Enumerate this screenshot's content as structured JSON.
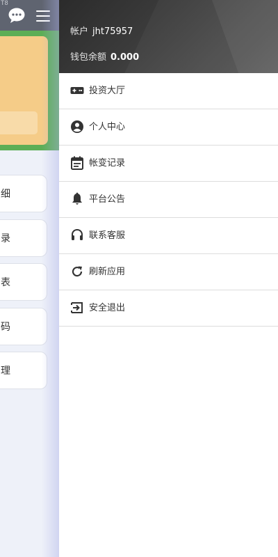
{
  "background_app": {
    "corner_text": "T8",
    "list_items": [
      {
        "label": "细"
      },
      {
        "label": "录"
      },
      {
        "label": "表"
      },
      {
        "label": "码"
      },
      {
        "label": "理"
      }
    ]
  },
  "drawer": {
    "account_label": "帐户",
    "account_value": "jht75957",
    "balance_label": "钱包余额",
    "balance_value": "0.000",
    "menu": [
      {
        "label": "投资大厅",
        "icon": "gamepad-icon"
      },
      {
        "label": "个人中心",
        "icon": "user-circle-icon"
      },
      {
        "label": "帐变记录",
        "icon": "calendar-icon"
      },
      {
        "label": "平台公告",
        "icon": "bell-icon"
      },
      {
        "label": "联系客服",
        "icon": "headset-icon"
      },
      {
        "label": "刷新应用",
        "icon": "refresh-icon"
      },
      {
        "label": "安全退出",
        "icon": "logout-icon"
      }
    ]
  },
  "colors": {
    "drawer_header": "#3b3b3b",
    "topbar": "#5f6470",
    "green_banner": "#5cae56",
    "card": "#f5cc88",
    "icon": "#333333"
  }
}
